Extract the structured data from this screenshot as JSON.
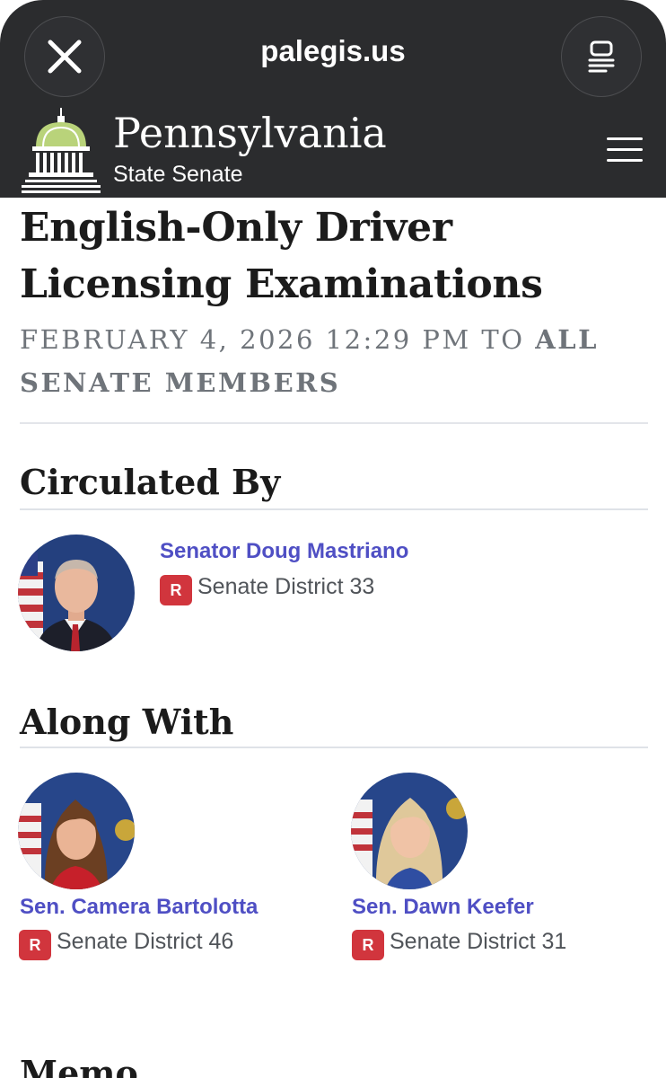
{
  "browser": {
    "url": "palegis.us"
  },
  "site": {
    "state": "Pennsylvania",
    "chamber": "State Senate"
  },
  "memo": {
    "title": "English-Only Driver Licensing Examinations",
    "date_line": "February 4, 2026 12:29 PM to",
    "audience": "All Senate Members"
  },
  "circulated_by": {
    "heading": "Circulated By",
    "senator": {
      "name": "Senator Doug Mastriano",
      "party": "R",
      "district": "Senate District 33"
    }
  },
  "along_with": {
    "heading": "Along With",
    "senators": [
      {
        "name": "Sen. Camera Bartolotta",
        "party": "R",
        "district": "Senate District 46"
      },
      {
        "name": "Sen. Dawn Keefer",
        "party": "R",
        "district": "Senate District 31"
      }
    ]
  },
  "next_section": {
    "heading": "Memo"
  },
  "icons": {
    "close": "close-icon",
    "reader": "reader-mode-icon",
    "logo": "capitol-dome-icon",
    "menu": "hamburger-menu-icon"
  },
  "colors": {
    "header_bg": "#2b2c2e",
    "link": "#4f4fc4",
    "party_republican": "#d1353d",
    "meta_text": "#6f747a"
  }
}
